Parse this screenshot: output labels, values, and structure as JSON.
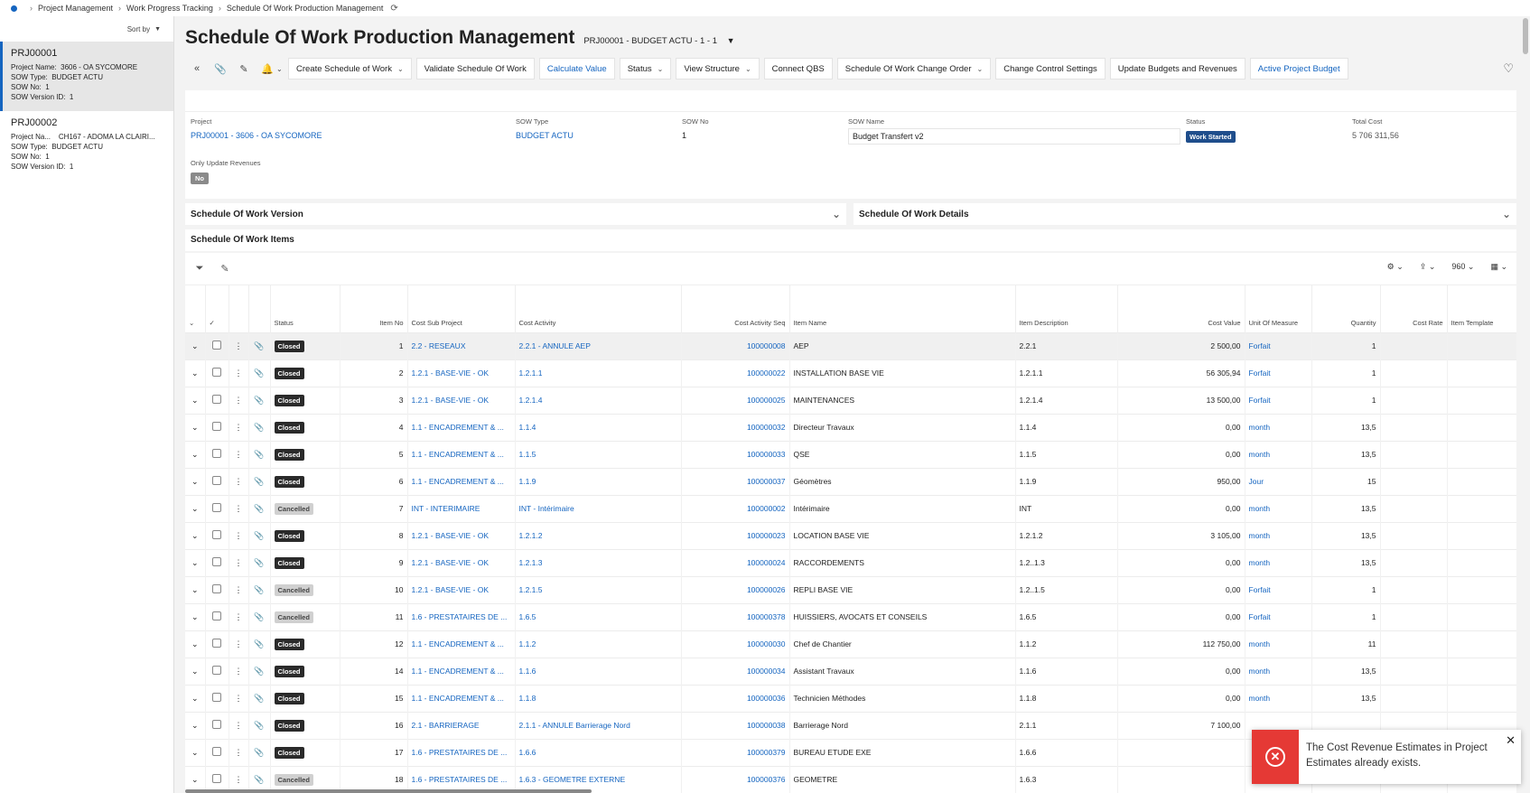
{
  "breadcrumb": [
    "Project Management",
    "Work Progress Tracking",
    "Schedule Of Work Production Management"
  ],
  "sidebar": {
    "sort_label": "Sort by",
    "projects": [
      {
        "id": "PRJ00001",
        "rows": [
          {
            "label": "Project Name:",
            "value": "3606 - OA SYCOMORE"
          },
          {
            "label": "SOW Type:",
            "value": "BUDGET ACTU"
          },
          {
            "label": "SOW No:",
            "value": "1"
          },
          {
            "label": "SOW Version ID:",
            "value": "1"
          }
        ]
      },
      {
        "id": "PRJ00002",
        "rows": [
          {
            "label": "Project Na...",
            "value": "CH167 - ADOMA LA CLAIRI..."
          },
          {
            "label": "SOW Type:",
            "value": "BUDGET ACTU"
          },
          {
            "label": "SOW No:",
            "value": "1"
          },
          {
            "label": "SOW Version ID:",
            "value": "1"
          }
        ]
      }
    ]
  },
  "page": {
    "title": "Schedule Of Work Production Management",
    "subtitle": "PRJ00001 - BUDGET ACTU - 1 - 1"
  },
  "toolbar": {
    "buttons": [
      {
        "label": "Create Schedule of Work",
        "dropdown": true
      },
      {
        "label": "Validate Schedule Of Work"
      },
      {
        "label": "Calculate Value",
        "blue": true
      },
      {
        "label": "Status",
        "dropdown": true
      },
      {
        "label": "View Structure",
        "dropdown": true
      },
      {
        "label": "Connect QBS"
      },
      {
        "label": "Schedule Of Work Change Order",
        "dropdown": true
      },
      {
        "label": "Change Control Settings"
      },
      {
        "label": "Update Budgets and Revenues"
      },
      {
        "label": "Active Project Budget",
        "blue": true
      }
    ]
  },
  "header": {
    "project_label": "Project",
    "project_value": "PRJ00001 - 3606 - OA SYCOMORE",
    "sow_type_label": "SOW Type",
    "sow_type_value": "BUDGET ACTU",
    "sow_no_label": "SOW No",
    "sow_no_value": "1",
    "sow_name_label": "SOW Name",
    "sow_name_value": "Budget Transfert v2",
    "status_label": "Status",
    "status_value": "Work Started",
    "total_cost_label": "Total Cost",
    "total_cost_value": "5 706 311,56",
    "only_update_label": "Only Update Revenues",
    "only_update_value": "No"
  },
  "panels": {
    "version": "Schedule Of Work Version",
    "details": "Schedule Of Work Details",
    "items": "Schedule Of Work Items"
  },
  "grid_tools": {
    "page_size": "960"
  },
  "grid": {
    "columns": [
      "Status",
      "Item No",
      "Cost Sub Project",
      "Cost Activity",
      "Cost Activity Seq",
      "Item Name",
      "Item Description",
      "Cost Value",
      "Unit Of Measure",
      "Quantity",
      "Cost Rate",
      "Item Template"
    ],
    "rows": [
      {
        "status": "Closed",
        "no": "1",
        "sub": "2.2 - RESEAUX",
        "act": "2.2.1 - ANNULE AEP",
        "seq": "100000008",
        "name": "AEP",
        "desc": "2.2.1",
        "value": "2 500,00",
        "uom": "Forfait",
        "qty": "1"
      },
      {
        "status": "Closed",
        "no": "2",
        "sub": "1.2.1 - BASE-VIE - OK",
        "act": "1.2.1.1",
        "seq": "100000022",
        "name": "INSTALLATION BASE VIE",
        "desc": "1.2.1.1",
        "value": "56 305,94",
        "uom": "Forfait",
        "qty": "1"
      },
      {
        "status": "Closed",
        "no": "3",
        "sub": "1.2.1 - BASE-VIE - OK",
        "act": "1.2.1.4",
        "seq": "100000025",
        "name": "MAINTENANCES",
        "desc": "1.2.1.4",
        "value": "13 500,00",
        "uom": "Forfait",
        "qty": "1"
      },
      {
        "status": "Closed",
        "no": "4",
        "sub": "1.1 - ENCADREMENT & ...",
        "act": "1.1.4",
        "seq": "100000032",
        "name": "Directeur Travaux",
        "desc": "1.1.4",
        "value": "0,00",
        "uom": "month",
        "qty": "13,5"
      },
      {
        "status": "Closed",
        "no": "5",
        "sub": "1.1 - ENCADREMENT & ...",
        "act": "1.1.5",
        "seq": "100000033",
        "name": "QSE",
        "desc": "1.1.5",
        "value": "0,00",
        "uom": "month",
        "qty": "13,5"
      },
      {
        "status": "Closed",
        "no": "6",
        "sub": "1.1 - ENCADREMENT & ...",
        "act": "1.1.9",
        "seq": "100000037",
        "name": "Géomètres",
        "desc": "1.1.9",
        "value": "950,00",
        "uom": "Jour",
        "qty": "15"
      },
      {
        "status": "Cancelled",
        "no": "7",
        "sub": "INT - INTERIMAIRE",
        "act": "INT - Intérimaire",
        "seq": "100000002",
        "name": "Intérimaire",
        "desc": "INT",
        "value": "0,00",
        "uom": "month",
        "qty": "13,5"
      },
      {
        "status": "Closed",
        "no": "8",
        "sub": "1.2.1 - BASE-VIE - OK",
        "act": "1.2.1.2",
        "seq": "100000023",
        "name": "LOCATION BASE VIE",
        "desc": "1.2.1.2",
        "value": "3 105,00",
        "uom": "month",
        "qty": "13,5"
      },
      {
        "status": "Closed",
        "no": "9",
        "sub": "1.2.1 - BASE-VIE - OK",
        "act": "1.2.1.3",
        "seq": "100000024",
        "name": "RACCORDEMENTS",
        "desc": "1.2..1.3",
        "value": "0,00",
        "uom": "month",
        "qty": "13,5"
      },
      {
        "status": "Cancelled",
        "no": "10",
        "sub": "1.2.1 - BASE-VIE - OK",
        "act": "1.2.1.5",
        "seq": "100000026",
        "name": "REPLI BASE VIE",
        "desc": "1.2..1.5",
        "value": "0,00",
        "uom": "Forfait",
        "qty": "1"
      },
      {
        "status": "Cancelled",
        "no": "11",
        "sub": "1.6 - PRESTATAIRES DE ...",
        "act": "1.6.5",
        "seq": "100000378",
        "name": "HUISSIERS, AVOCATS ET CONSEILS",
        "desc": "1.6.5",
        "value": "0,00",
        "uom": "Forfait",
        "qty": "1"
      },
      {
        "status": "Closed",
        "no": "12",
        "sub": "1.1 - ENCADREMENT & ...",
        "act": "1.1.2",
        "seq": "100000030",
        "name": "Chef de Chantier",
        "desc": "1.1.2",
        "value": "112 750,00",
        "uom": "month",
        "qty": "11"
      },
      {
        "status": "Closed",
        "no": "14",
        "sub": "1.1 - ENCADREMENT & ...",
        "act": "1.1.6",
        "seq": "100000034",
        "name": "Assistant Travaux",
        "desc": "1.1.6",
        "value": "0,00",
        "uom": "month",
        "qty": "13,5"
      },
      {
        "status": "Closed",
        "no": "15",
        "sub": "1.1 - ENCADREMENT & ...",
        "act": "1.1.8",
        "seq": "100000036",
        "name": "Technicien Méthodes",
        "desc": "1.1.8",
        "value": "0,00",
        "uom": "month",
        "qty": "13,5"
      },
      {
        "status": "Closed",
        "no": "16",
        "sub": "2.1 - BARRIERAGE",
        "act": "2.1.1 - ANNULE Barrierage Nord",
        "seq": "100000038",
        "name": "Barrierage Nord",
        "desc": "2.1.1",
        "value": "7 100,00",
        "uom": "",
        "qty": ""
      },
      {
        "status": "Closed",
        "no": "17",
        "sub": "1.6 - PRESTATAIRES DE ...",
        "act": "1.6.6",
        "seq": "100000379",
        "name": "BUREAU ETUDE EXE",
        "desc": "1.6.6",
        "value": "",
        "uom": "",
        "qty": ""
      },
      {
        "status": "Cancelled",
        "no": "18",
        "sub": "1.6 - PRESTATAIRES DE ...",
        "act": "1.6.3 - GEOMETRE EXTERNE",
        "seq": "100000376",
        "name": "GEOMETRE",
        "desc": "1.6.3",
        "value": "",
        "uom": "",
        "qty": ""
      }
    ]
  },
  "toast": {
    "message": "The Cost Revenue Estimates in Project Estimates already exists."
  }
}
